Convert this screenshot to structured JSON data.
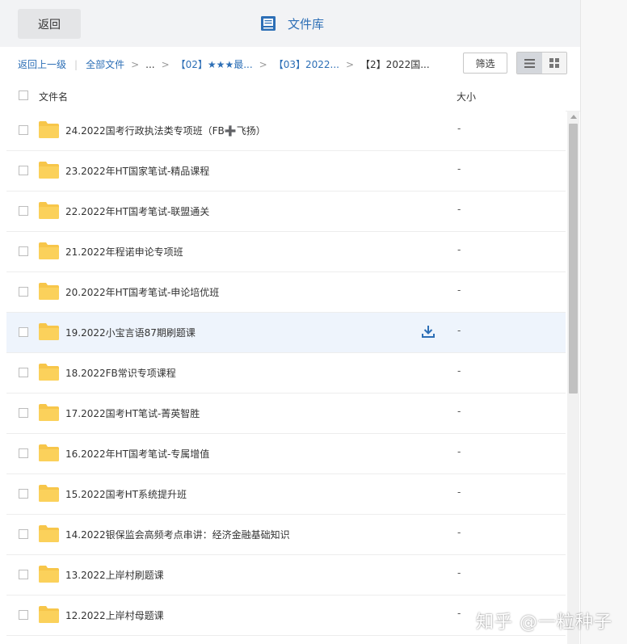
{
  "header": {
    "back_label": "返回",
    "title": "文件库"
  },
  "breadcrumb": {
    "up_one": "返回上一级",
    "all_files": "全部文件",
    "ellipsis": "...",
    "seg1": "【02】★★★最...",
    "seg2": "【03】2022...",
    "current": "【2】2022国..."
  },
  "toolbar": {
    "filter_label": "筛选"
  },
  "columns": {
    "name": "文件名",
    "size": "大小"
  },
  "files": [
    {
      "name": "24.2022国考行政执法类专项班（FB➕飞扬）",
      "size": "-"
    },
    {
      "name": "23.2022年HT国家笔试-精品课程",
      "size": "-"
    },
    {
      "name": "22.2022年HT国考笔试-联盟通关",
      "size": "-"
    },
    {
      "name": "21.2022年程诺申论专项班",
      "size": "-"
    },
    {
      "name": "20.2022年HT国考笔试-申论培优班",
      "size": "-"
    },
    {
      "name": "19.2022小宝言语87期刷题课",
      "size": "-"
    },
    {
      "name": "18.2022FB常识专项课程",
      "size": "-"
    },
    {
      "name": "17.2022国考HT笔试-菁英智胜",
      "size": "-"
    },
    {
      "name": "16.2022年HT国考笔试-专属增值",
      "size": "-"
    },
    {
      "name": "15.2022国考HT系统提升班",
      "size": "-"
    },
    {
      "name": "14.2022银保监会高频考点串讲：经济金融基础知识",
      "size": "-"
    },
    {
      "name": "13.2022上岸村刷题课",
      "size": "-"
    },
    {
      "name": "12.2022上岸村母题课",
      "size": "-"
    }
  ],
  "hover_row_index": 5,
  "watermark": "知乎 @一粒种子",
  "colors": {
    "accent": "#2d6fb6",
    "folder": "#f7c64a",
    "hover": "#eef4fc"
  }
}
